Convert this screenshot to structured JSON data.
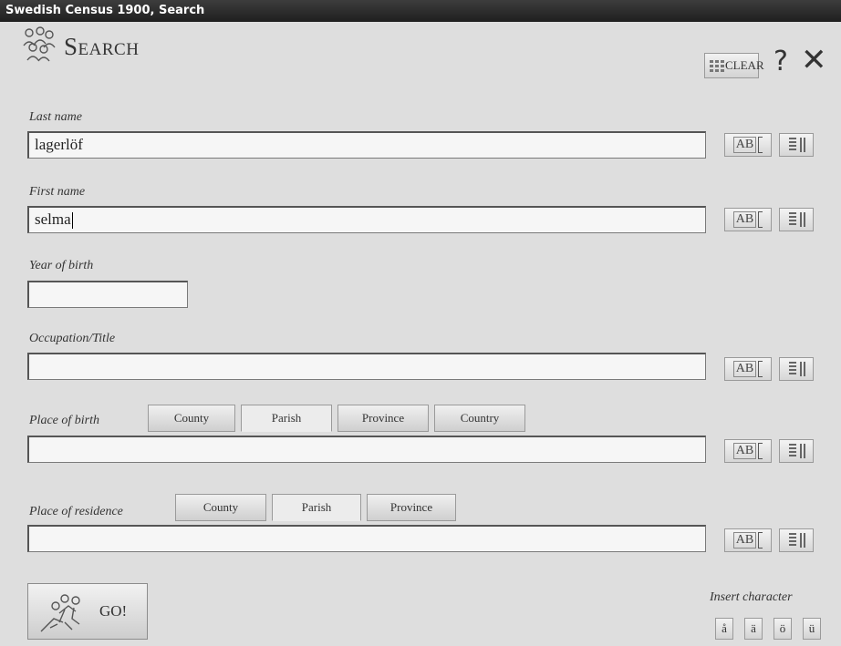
{
  "window": {
    "title": "Swedish Census 1900, Search"
  },
  "header": {
    "title": "Search",
    "clear_label": "CLEAR",
    "help_glyph": "?",
    "close_glyph": "✕"
  },
  "fields": {
    "last_name": {
      "label": "Last name",
      "value": "lagerlöf"
    },
    "first_name": {
      "label": "First name",
      "value": "selma"
    },
    "year_of_birth": {
      "label": "Year of birth",
      "value": ""
    },
    "occupation": {
      "label": "Occupation/Title",
      "value": ""
    },
    "place_of_birth": {
      "label": "Place of birth",
      "value": "",
      "tabs": [
        "County",
        "Parish",
        "Province",
        "Country"
      ],
      "active_tab": "Parish"
    },
    "place_of_residence": {
      "label": "Place of residence",
      "value": "",
      "tabs": [
        "County",
        "Parish",
        "Province"
      ],
      "active_tab": "Parish"
    }
  },
  "tools": {
    "ab_label": "AB",
    "ab_icon": "text-case-icon",
    "list_icon": "list-icon"
  },
  "footer": {
    "go_label": "GO!",
    "insert_character_label": "Insert character",
    "characters": [
      "å",
      "ä",
      "ö",
      "ü"
    ]
  },
  "colors": {
    "titlebar": "#2a2a2a",
    "background": "#dedede"
  }
}
